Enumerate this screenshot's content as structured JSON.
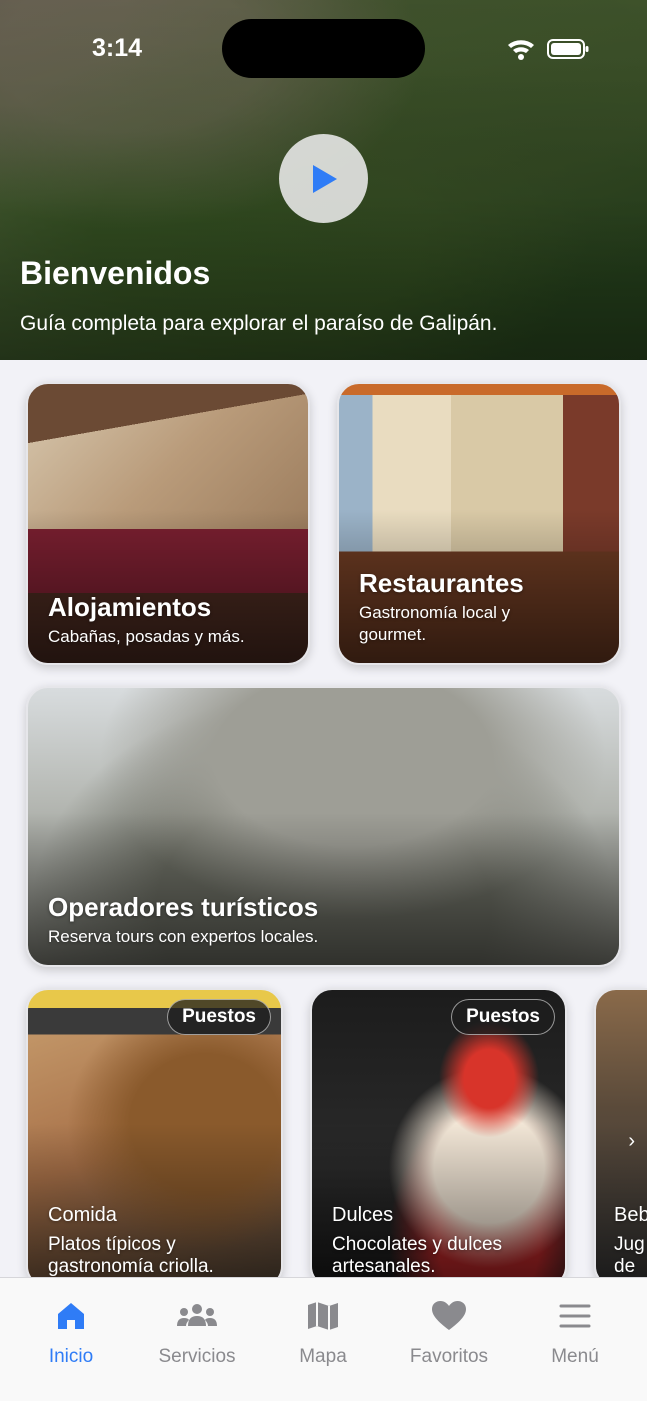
{
  "status_bar": {
    "time": "3:14"
  },
  "hero": {
    "title": "Bienvenidos",
    "subtitle": "Guía completa para explorar el paraíso de Galipán."
  },
  "cards": {
    "alojamientos": {
      "title": "Alojamientos",
      "subtitle": "Cabañas, posadas y más."
    },
    "restaurantes": {
      "title": "Restaurantes",
      "subtitle_line1": "Gastronomía local y",
      "subtitle_line2": "gourmet."
    },
    "operadores": {
      "title": "Operadores turísticos",
      "subtitle": "Reserva tours con expertos locales."
    }
  },
  "carousel": [
    {
      "badge": "Puestos",
      "title": "Comida",
      "subtitle_line1": "Platos típicos y",
      "subtitle_line2": "gastronomía criolla."
    },
    {
      "badge": "Puestos",
      "title": "Dulces",
      "subtitle_line1": "Chocolates y dulces",
      "subtitle_line2": "artesanales."
    },
    {
      "title": "Beb",
      "subtitle_line1": "Jug",
      "subtitle_line2": "de n"
    }
  ],
  "tabbar": {
    "items": [
      {
        "label": "Inicio",
        "icon": "house-icon",
        "active": true
      },
      {
        "label": "Servicios",
        "icon": "people-icon"
      },
      {
        "label": "Mapa",
        "icon": "map-icon"
      },
      {
        "label": "Favoritos",
        "icon": "heart-icon"
      },
      {
        "label": "Menú",
        "icon": "menu-icon"
      }
    ]
  },
  "colors": {
    "accent": "#2f7cf6",
    "inactive": "#8a8a8e",
    "background": "#f2f2f7"
  }
}
